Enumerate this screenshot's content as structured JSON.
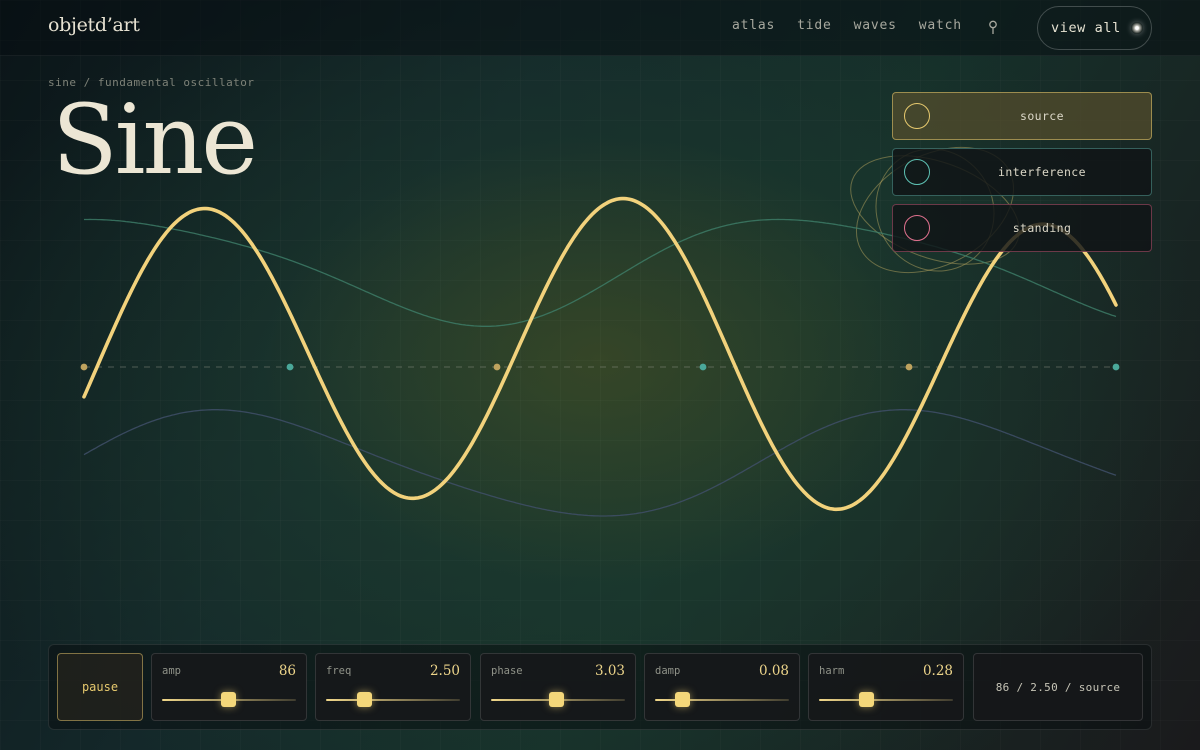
{
  "app": {
    "logo": "objetd’art"
  },
  "nav": {
    "links": [
      "atlas",
      "tide",
      "waves",
      "watch"
    ],
    "pin_icon": "location-pin-icon",
    "view_all_label": "view all",
    "view_all_icon": "spark-icon"
  },
  "breadcrumb": "sine / fundamental oscillator",
  "title": "Sine",
  "modes": [
    {
      "label": "source",
      "color": "#e6c96e",
      "active": true
    },
    {
      "label": "interference",
      "color": "#5ec2b4",
      "active": false
    },
    {
      "label": "standing",
      "color": "#e0718e",
      "active": false
    }
  ],
  "controls": {
    "pause_label": "pause",
    "sliders": [
      {
        "label": "amp",
        "value": "86",
        "level": 0.49
      },
      {
        "label": "freq",
        "value": "2.50",
        "level": 0.28
      },
      {
        "label": "phase",
        "value": "3.03",
        "level": 0.48
      },
      {
        "label": "damp",
        "value": "0.08",
        "level": 0.2
      },
      {
        "label": "harm",
        "value": "0.28",
        "level": 0.35
      }
    ],
    "readout": "86 / 2.50 / source"
  },
  "colors": {
    "primary_wave": "#f2d27c",
    "teal_wave": "#3f7f6a",
    "slate_wave": "#3f4f68",
    "node_gold": "#bfa35e",
    "node_teal": "#4aa89a"
  }
}
